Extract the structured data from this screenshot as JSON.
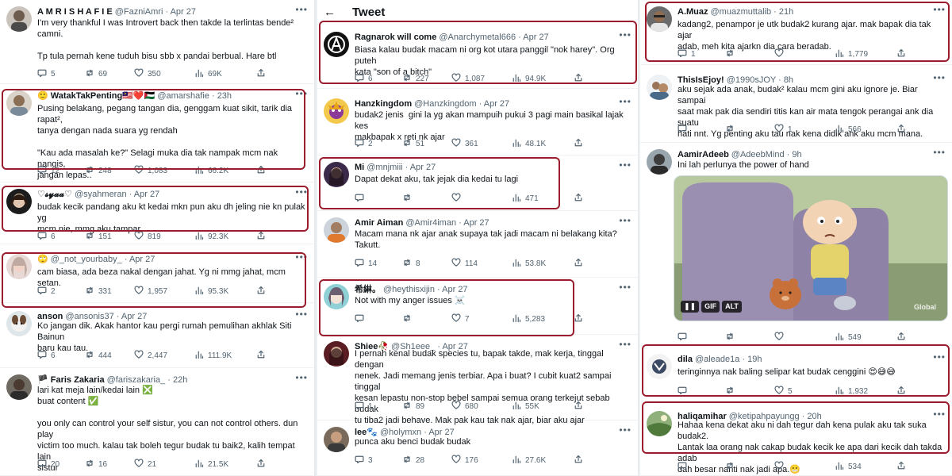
{
  "colors": {
    "accent": "#9b1c2c",
    "text": "#0f1419",
    "muted": "#536471"
  },
  "col2_header": {
    "back_label": "←",
    "title": "Tweet"
  },
  "col1": [
    {
      "name": "A M R I S H A F I E",
      "handle": "@FazniAmri",
      "time": "Apr 27",
      "body": "I'm very thankful I was Introvert back then takde la terlintas bende²\ncamni.\n\nTp tula pernah kene tuduh bisu sbb x pandai berbual. Hare btl",
      "replies": "5",
      "retweets": "69",
      "likes": "350",
      "views": "69K"
    },
    {
      "name": "🙂 WatakTakPenting🇲🇾❤️🇵🇸",
      "handle": "@amarshafie",
      "time": "23h",
      "body": "Pusing belakang, pegang tangan dia, genggam kuat sikit, tarik dia rapat²,\ntanya dengan nada suara yg rendah\n\n\"Kau ada masalah ke?\" Selagi muka dia tak nampak mcm nak nangis,\njangan lepas..",
      "replies": "12",
      "retweets": "248",
      "likes": "1,083",
      "views": "66.2K"
    },
    {
      "name": "♡𝓼𝔂𝓪𝓪♡",
      "handle": "@syahmeran",
      "time": "Apr 27",
      "body": "budak kecik pandang aku kt kedai mkn pun aku dh jeling nie kn pulak yg\nmcm nie, mmg aku tampar",
      "replies": "6",
      "retweets": "151",
      "likes": "819",
      "views": "92.3K"
    },
    {
      "name": "🙄",
      "handle": "@_not_yourbaby_",
      "time": "Apr 27",
      "body": "cam biasa, ada beza nakal dengan jahat. Yg ni mmg jahat, mcm setan.",
      "replies": "2",
      "retweets": "331",
      "likes": "1,957",
      "views": "95.3K"
    },
    {
      "name": "anson",
      "handle": "@ansonis37",
      "time": "Apr 27",
      "body": "Ko jangan dik. Akak hantor kau pergi rumah pemulihan akhlak Siti Bainun\nbaru kau tau.",
      "replies": "6",
      "retweets": "444",
      "likes": "2,447",
      "views": "111.9K"
    },
    {
      "name": "🏴 Faris Zakaria",
      "handle": "@fariszakaria_",
      "time": "22h",
      "body": "lari kat meja lain/kedai lain ❎\nbuat content ✅\n\nyou only can control your self sistur, you can not control others. dun play\nvictim too much. kalau tak boleh tegur budak tu baik2, kalih tempat lain\nsistur",
      "replies": "20",
      "retweets": "16",
      "likes": "21",
      "views": "21.5K"
    }
  ],
  "col2": [
    {
      "name": "Ragnarok will come",
      "handle": "@Anarchymetal666",
      "time": "Apr 27",
      "body": "Biasa kalau budak macam ni org kot utara panggil \"nok harey\". Org puteh\nkata \"son of a bitch\"",
      "replies": "6",
      "retweets": "227",
      "likes": "1,087",
      "views": "94.9K"
    },
    {
      "name": "Hanzkingdom",
      "handle": "@Hanzkingdom",
      "time": "Apr 27",
      "body": "budak2 jenis  gini la yg akan mampuih pukui 3 pagi main basikal lajak kes\nmakbapak x reti nk ajar",
      "replies": "2",
      "retweets": "51",
      "likes": "361",
      "views": "48.1K"
    },
    {
      "name": "Mi",
      "handle": "@mnjmiii",
      "time": "Apr 27",
      "body": "Dapat dekat aku, tak jejak dia kedai tu lagi",
      "replies": "",
      "retweets": "",
      "likes": "",
      "views": "471"
    },
    {
      "name": "Amir Aiman",
      "handle": "@Amir4iman",
      "time": "Apr 27",
      "body": "Macam mana nk ajar anak supaya tak jadi macam ni belakang kita?\nTakutt.",
      "replies": "14",
      "retweets": "8",
      "likes": "114",
      "views": "53.8K"
    },
    {
      "name": "希綝。",
      "handle": "@heythisxijin",
      "time": "Apr 27",
      "body": "Not with my anger issues ☠️",
      "replies": "",
      "retweets": "",
      "likes": "7",
      "views": "5,283"
    },
    {
      "name": "Shiee🥀",
      "handle": "@Sh1eee_",
      "time": "Apr 27",
      "body": "I pernah kenal budak species tu, bapak takde, mak kerja, tinggal dengan\nnenek. Jadi memang jenis terbiar. Apa i buat? I cubit kuat2 sampai tinggal\nkesan lepastu non-stop bebel sampai semua orang terkejut sebab budak\ntu tiba2 jadi behave. Mak pak kau tak nak ajar, biar aku ajar",
      "replies": "1",
      "retweets": "89",
      "likes": "680",
      "views": "55K"
    },
    {
      "name": "lee🐾",
      "handle": "@holymxn",
      "time": "Apr 27",
      "body": "punca aku benci budak budak",
      "replies": "3",
      "retweets": "28",
      "likes": "176",
      "views": "27.6K"
    }
  ],
  "col3": [
    {
      "name": "A.Muaz",
      "handle": "@muazmuttalib",
      "time": "21h",
      "body": "kadang2, penampor je utk budak2 kurang ajar. mak bapak dia tak ajar\nadab, meh kita ajarkn dia cara beradab.",
      "replies": "1",
      "retweets": "",
      "likes": "",
      "views": "1,779"
    },
    {
      "name": "ThisIsEjoy!",
      "handle": "@1990sJOY",
      "time": "8h",
      "body": "aku sejak ada anak, budak² kalau mcm gini aku ignore je. Biar sampai\nsaat mak pak dia sendiri titis kan air mata tengok perangai ank dia suatu\nhati nnt. Yg penting aku tau nak kena didik ank aku mcm mana.",
      "replies": "",
      "retweets": "",
      "likes": "1",
      "views": "566"
    },
    {
      "name": "AamirAdeeb",
      "handle": "@AdeebMind",
      "time": "9h",
      "body": "Ini lah perlunya the power of hand",
      "replies": "",
      "retweets": "",
      "likes": "",
      "views": "549",
      "media_badges": [
        "GIF",
        "ALT"
      ],
      "media_watermark": "Global"
    },
    {
      "name": "dila",
      "handle": "@aleade1a",
      "time": "19h",
      "body": "teringinnya nak baling selipar kat budak cenggini 😍😅😅",
      "replies": "",
      "retweets": "",
      "likes": "5",
      "views": "1,932"
    },
    {
      "name": "haliqamihar",
      "handle": "@ketipahpayungg",
      "time": "20h",
      "body": "Hahaa kena dekat aku ni dah tegur dah kena pulak aku tak suka budak2.\nLantak laa orang nak cakap budak kecik ke apa dari kecik dah takda adab\ndah besar nanti nak jadi apa.😬",
      "replies": "",
      "retweets": "",
      "likes": "",
      "views": "534"
    }
  ]
}
